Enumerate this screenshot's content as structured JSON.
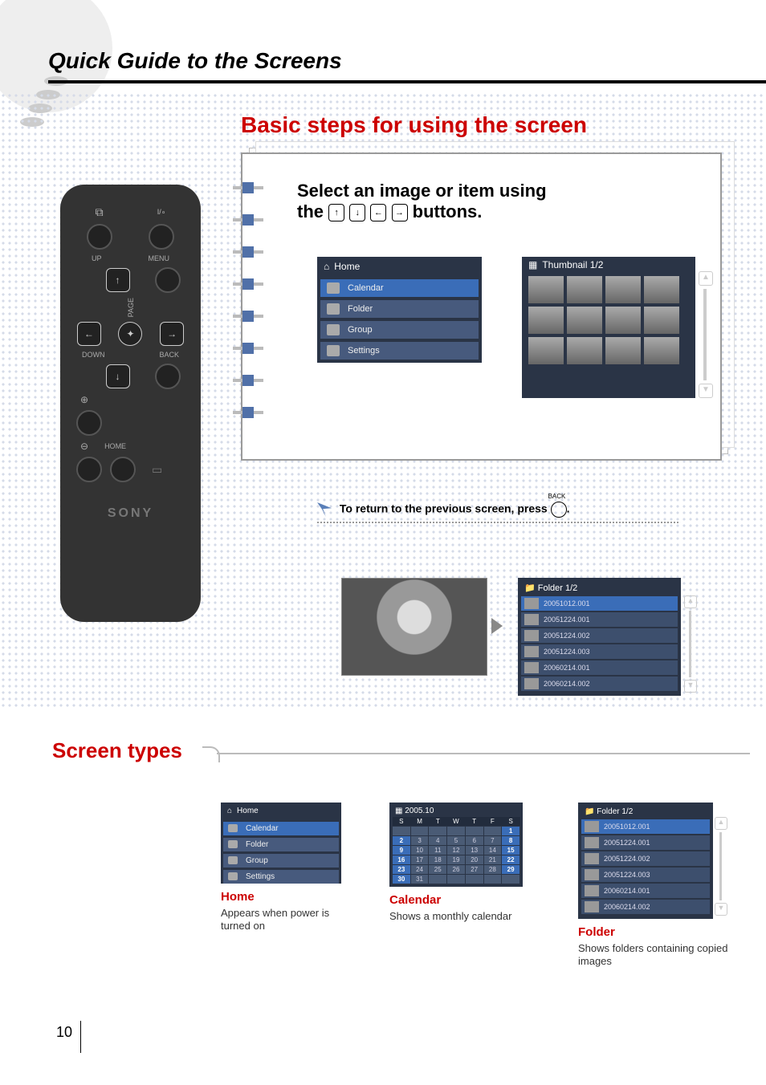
{
  "title": "Quick Guide to the Screens",
  "section_basic": "Basic steps for using the screen",
  "step_text_a": "Select an image or item using",
  "step_text_b": "the",
  "step_text_c": "buttons.",
  "remote": {
    "up": "UP",
    "menu": "MENU",
    "page": "PAGE",
    "down": "DOWN",
    "back": "BACK",
    "home": "HOME",
    "power": "I/∘",
    "brand": "SONY"
  },
  "home_menu": {
    "header": "Home",
    "items": [
      "Calendar",
      "Folder",
      "Group",
      "Settings"
    ]
  },
  "thumbnail_header": "Thumbnail 1/2",
  "tip": "To return to the previous screen, press",
  "tip_back_label": "BACK",
  "folder_list": {
    "header": "Folder 1/2",
    "items": [
      "20051012.001",
      "20051224.001",
      "20051224.002",
      "20051224.003",
      "20060214.001",
      "20060214.002"
    ]
  },
  "screen_types_title": "Screen types",
  "cards": {
    "home": {
      "title": "Home",
      "desc": "Appears when power is turned on"
    },
    "cal": {
      "title": "Calendar",
      "desc": "Shows a monthly calendar"
    },
    "folder": {
      "title": "Folder",
      "desc": "Shows folders containing copied images"
    }
  },
  "calendar": {
    "title": "2005.10",
    "dow": [
      "S",
      "M",
      "T",
      "W",
      "T",
      "F",
      "S"
    ],
    "weeks": [
      [
        "",
        "",
        "",
        "",
        "",
        "",
        "1"
      ],
      [
        "2",
        "3",
        "4",
        "5",
        "6",
        "7",
        "8"
      ],
      [
        "9",
        "10",
        "11",
        "12",
        "13",
        "14",
        "15"
      ],
      [
        "16",
        "17",
        "18",
        "19",
        "20",
        "21",
        "22"
      ],
      [
        "23",
        "24",
        "25",
        "26",
        "27",
        "28",
        "29"
      ],
      [
        "30",
        "31",
        "",
        "",
        "",
        "",
        ""
      ]
    ],
    "highlights": [
      "2",
      "9",
      "16",
      "23",
      "30",
      "1",
      "8",
      "15",
      "22",
      "29"
    ]
  },
  "page_number": "10"
}
